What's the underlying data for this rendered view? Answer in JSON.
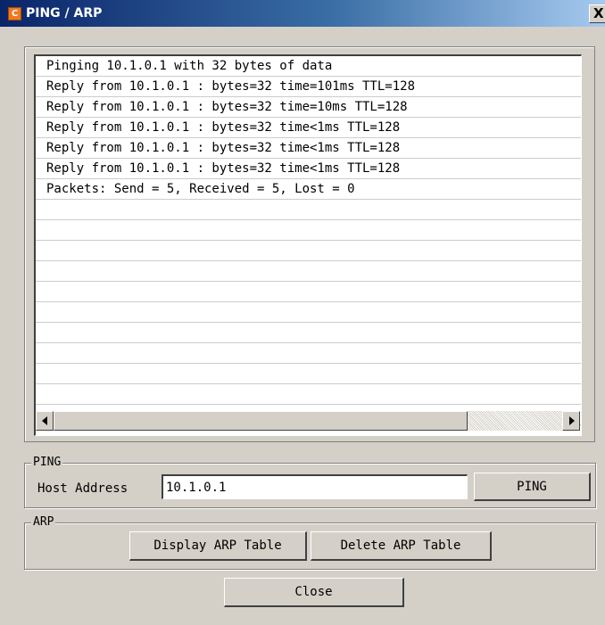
{
  "window": {
    "title": "PING / ARP",
    "app_icon_glyph": "C",
    "close_glyph": "X"
  },
  "output": {
    "lines": [
      "Pinging 10.1.0.1 with 32 bytes of data",
      "Reply from 10.1.0.1 : bytes=32 time=101ms TTL=128",
      "Reply from 10.1.0.1 : bytes=32 time=10ms TTL=128",
      "Reply from 10.1.0.1 : bytes=32 time<1ms TTL=128",
      "Reply from 10.1.0.1 : bytes=32 time<1ms TTL=128",
      "Reply from 10.1.0.1 : bytes=32 time<1ms TTL=128",
      "Packets: Send = 5, Received = 5, Lost = 0",
      "",
      "",
      "",
      "",
      "",
      "",
      "",
      "",
      "",
      "",
      ""
    ]
  },
  "ping": {
    "group_label": "PING",
    "host_label": "Host Address",
    "host_value": "10.1.0.1",
    "button_label": "PING"
  },
  "arp": {
    "group_label": "ARP",
    "display_label": "Display ARP Table",
    "delete_label": "Delete ARP Table"
  },
  "close_label": "Close",
  "colors": {
    "window_bg": "#d4d0c8",
    "titlebar_start": "#0a246a",
    "titlebar_end": "#a6caf0",
    "title_text": "#ffffff",
    "app_icon": "#f07a1c"
  },
  "icons": {
    "app": "cisco-app-icon",
    "close": "close-icon",
    "scroll_left": "scroll-left-arrow-icon",
    "scroll_right": "scroll-right-arrow-icon"
  }
}
